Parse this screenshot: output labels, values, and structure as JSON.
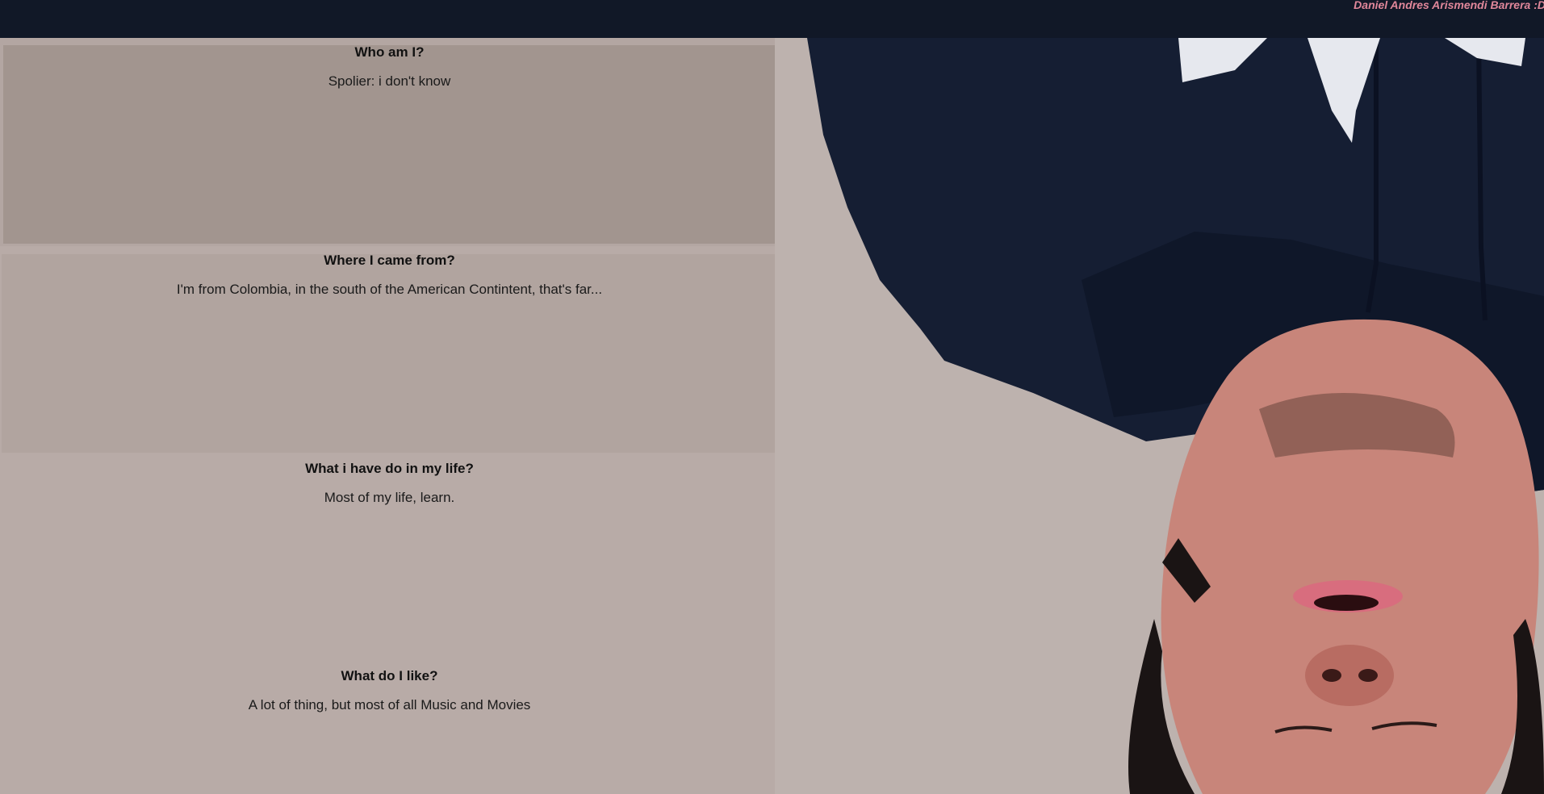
{
  "header": {
    "name": "Daniel Andres Arismendi Barrera :D"
  },
  "sections": [
    {
      "title": "Who am I?",
      "text": "Spolier: i don't know"
    },
    {
      "title": "Where I came from?",
      "text": "I'm from Colombia, in the south of the American Contintent, that's far..."
    },
    {
      "title": "What i have do in my life?",
      "text": "Most of my life, learn."
    },
    {
      "title": "What do I like?",
      "text": "A lot of thing, but most of all Music and Movies"
    }
  ],
  "photo": {
    "subject": "upside-down-portrait",
    "colors": {
      "background": "#bdb2ae",
      "hoodie": "#151e33",
      "skin": "#c8857a",
      "hair": "#1a1414",
      "logo": "#e6e8ee"
    }
  }
}
